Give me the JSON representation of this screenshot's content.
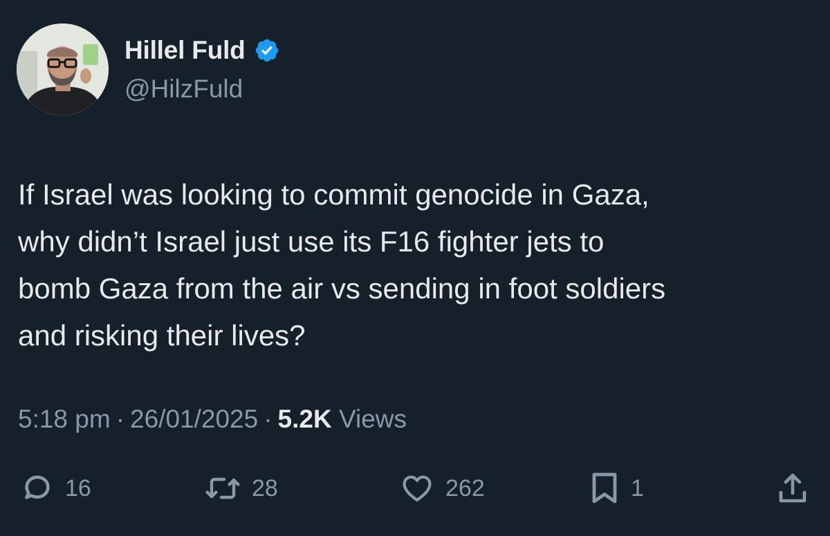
{
  "user": {
    "display_name": "Hillel Fuld",
    "handle": "@HilzFuld",
    "verified": true,
    "verified_icon": "verified-badge-icon",
    "verified_color": "#1d9bf0"
  },
  "tweet": {
    "lines": [
      "If Israel was looking to commit genocide in Gaza,",
      "why didn’t Israel just use its F16 fighter jets to",
      "bomb Gaza from the air vs sending in foot soldiers",
      "and risking their lives?"
    ]
  },
  "meta": {
    "time": "5:18 pm",
    "separator": "·",
    "date": "26/01/2025",
    "views_count": "5.2K",
    "views_label": "Views"
  },
  "actions": {
    "reply": {
      "icon": "reply-icon",
      "count": "16"
    },
    "retweet": {
      "icon": "retweet-icon",
      "count": "28"
    },
    "like": {
      "icon": "heart-icon",
      "count": "262"
    },
    "bookmark": {
      "icon": "bookmark-icon",
      "count": "1"
    },
    "share": {
      "icon": "share-icon"
    }
  },
  "colors": {
    "background": "#15202b",
    "text_primary": "#e7e9ea",
    "text_secondary": "#8b98a5",
    "icon": "#8b98a5"
  }
}
